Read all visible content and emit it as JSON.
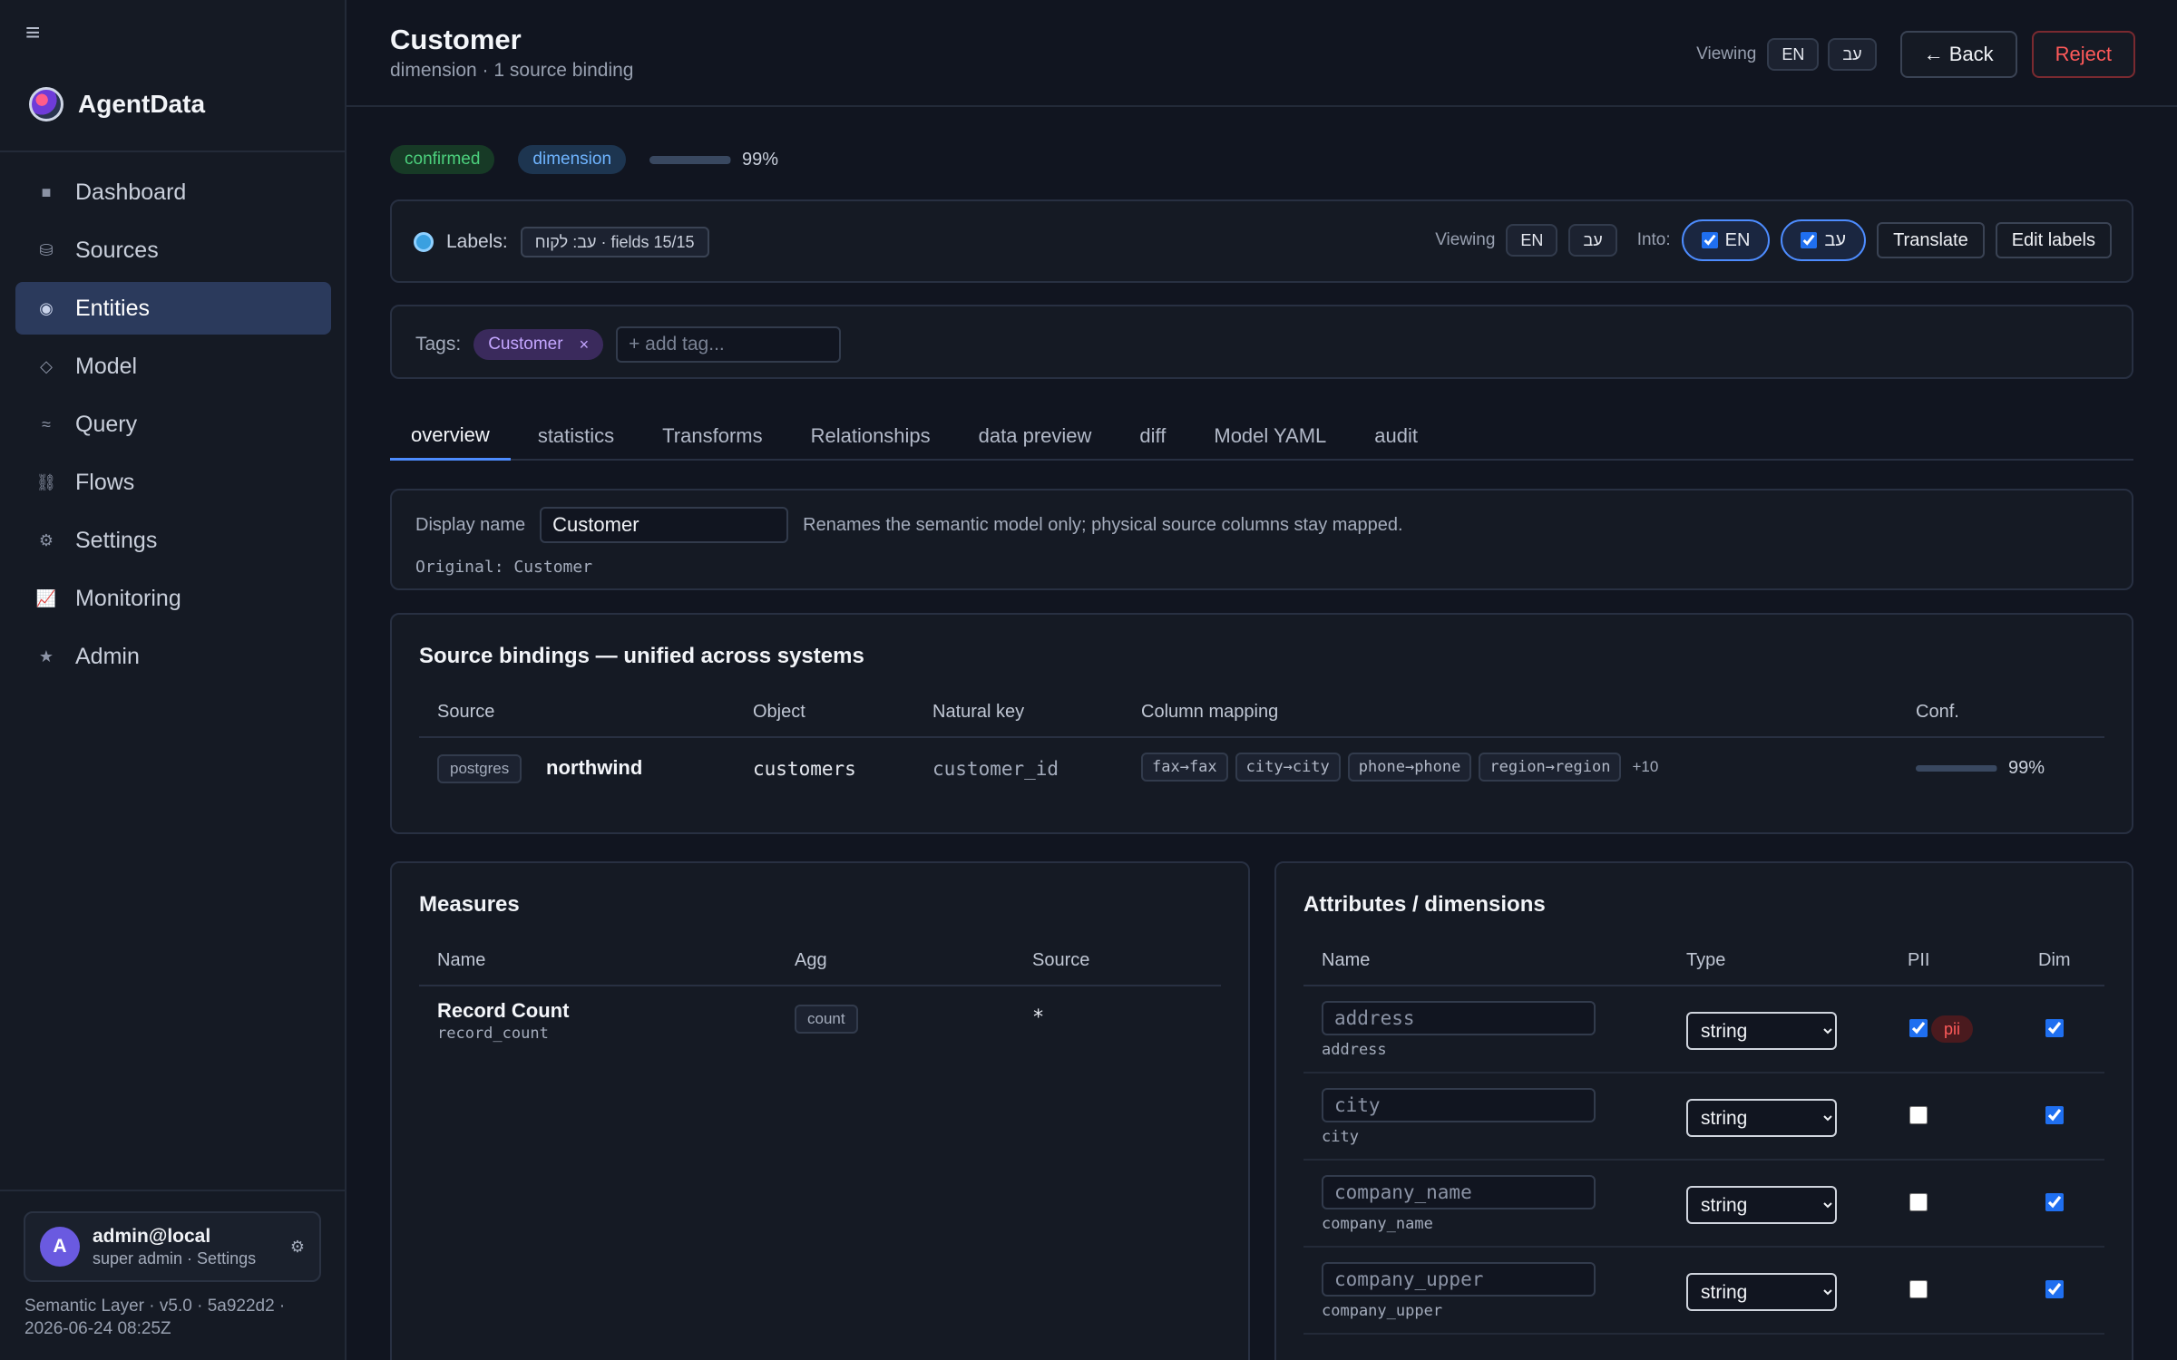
{
  "app": {
    "name": "AgentData",
    "version_line1": "Semantic Layer · v5.0 · 5a922d2 ·",
    "version_line2": "2026-06-24 08:25Z"
  },
  "sidebar": {
    "items": [
      {
        "label": "Dashboard",
        "icon": "square-icon",
        "glyph": "■",
        "active": false
      },
      {
        "label": "Sources",
        "icon": "database-icon",
        "glyph": "⛁",
        "active": false
      },
      {
        "label": "Entities",
        "icon": "entity-icon",
        "glyph": "◉",
        "active": true
      },
      {
        "label": "Model",
        "icon": "diamond-icon",
        "glyph": "◇",
        "active": false
      },
      {
        "label": "Query",
        "icon": "wave-icon",
        "glyph": "≈",
        "active": false
      },
      {
        "label": "Flows",
        "icon": "link-icon",
        "glyph": "⛓",
        "active": false
      },
      {
        "label": "Settings",
        "icon": "gear-icon",
        "glyph": "⚙",
        "active": false
      },
      {
        "label": "Monitoring",
        "icon": "chart-icon",
        "glyph": "📈",
        "active": false
      },
      {
        "label": "Admin",
        "icon": "star-icon",
        "glyph": "★",
        "active": false
      }
    ],
    "user": {
      "initial": "A",
      "name": "admin@local",
      "sub": "super admin · Settings"
    }
  },
  "header": {
    "title": "Customer",
    "subtitle": "dimension · 1 source binding",
    "viewing_label": "Viewing",
    "lang_en": "EN",
    "lang_he": "עב",
    "back_label": "← Back",
    "reject_label": "Reject"
  },
  "status": {
    "state": "confirmed",
    "kind": "dimension",
    "confidence": 0.99,
    "confidence_text": "99%"
  },
  "labels": {
    "label": "Labels:",
    "chip": "עב: לקוח · fields 15/15",
    "viewing_label": "Viewing",
    "lang_en": "EN",
    "lang_he": "עב",
    "into_label": "Into:",
    "into_en": "EN",
    "into_he": "עב",
    "translate_label": "Translate",
    "edit_label": "Edit labels"
  },
  "tags": {
    "label": "Tags:",
    "items": [
      "Customer"
    ],
    "remove_glyph": "×",
    "placeholder": "+ add tag..."
  },
  "tabs": [
    "overview",
    "statistics",
    "Transforms",
    "Relationships",
    "data preview",
    "diff",
    "Model YAML",
    "audit"
  ],
  "display_name": {
    "label": "Display name",
    "value": "Customer",
    "help": "Renames the semantic model only; physical source columns stay mapped.",
    "original": "Original: Customer"
  },
  "bindings": {
    "title": "Source bindings — unified across systems",
    "columns": [
      "Source",
      "Object",
      "Natural key",
      "Column mapping",
      "Conf."
    ],
    "rows": [
      {
        "source_type": "postgres",
        "source_name": "northwind",
        "object": "customers",
        "natural_key": "customer_id",
        "mappings": [
          "fax→fax",
          "city→city",
          "phone→phone",
          "region→region"
        ],
        "more": "+10",
        "confidence": 0.99,
        "confidence_text": "99%"
      }
    ]
  },
  "measures": {
    "title": "Measures",
    "columns": [
      "Name",
      "Agg",
      "Source"
    ],
    "rows": [
      {
        "name": "Record Count",
        "key": "record_count",
        "agg": "count",
        "source": "*"
      }
    ]
  },
  "attributes": {
    "title": "Attributes / dimensions",
    "columns": [
      "Name",
      "Type",
      "PII",
      "Dim"
    ],
    "rows": [
      {
        "placeholder": "address",
        "key": "address",
        "type": "string",
        "pii": true,
        "pii_badge": "pii",
        "dim": true
      },
      {
        "placeholder": "city",
        "key": "city",
        "type": "string",
        "pii": false,
        "dim": true
      },
      {
        "placeholder": "company_name",
        "key": "company_name",
        "type": "string",
        "pii": false,
        "dim": true
      },
      {
        "placeholder": "company_upper",
        "key": "company_upper",
        "type": "string",
        "pii": false,
        "dim": true
      }
    ]
  }
}
